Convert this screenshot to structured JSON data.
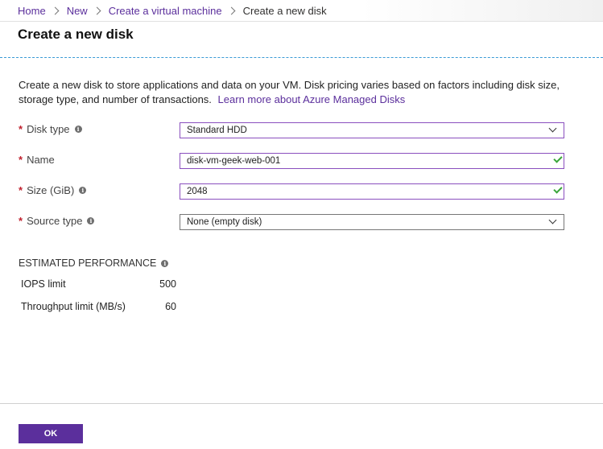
{
  "breadcrumb": {
    "items": [
      "Home",
      "New",
      "Create a virtual machine"
    ],
    "current": "Create a new disk"
  },
  "page": {
    "title": "Create a new disk",
    "description": "Create a new disk to store applications and data on your VM. Disk pricing varies based on factors including disk size, storage type, and number of transactions.",
    "learn_more_link": "Learn more about Azure Managed Disks"
  },
  "form": {
    "required_marker": "*",
    "info_glyph": "i",
    "disk_type": {
      "label": "Disk type",
      "value": "Standard HDD",
      "info_icon": "info-icon",
      "control": "dropdown"
    },
    "name": {
      "label": "Name",
      "value": "disk-vm-geek-web-001",
      "status": "valid"
    },
    "size": {
      "label": "Size (GiB)",
      "value": "2048",
      "info_icon": "info-icon",
      "status": "valid"
    },
    "source_type": {
      "label": "Source type",
      "value": "None (empty disk)",
      "info_icon": "info-icon",
      "control": "dropdown"
    }
  },
  "performance": {
    "title": "ESTIMATED PERFORMANCE",
    "rows": [
      {
        "label": "IOPS limit",
        "value": "500"
      },
      {
        "label": "Throughput limit (MB/s)",
        "value": "60"
      }
    ]
  },
  "footer": {
    "ok_label": "OK"
  },
  "colors": {
    "accent": "#5b2f9c",
    "required": "#c0212e",
    "valid": "#3aa63a",
    "divider": "#3a9bd6"
  }
}
